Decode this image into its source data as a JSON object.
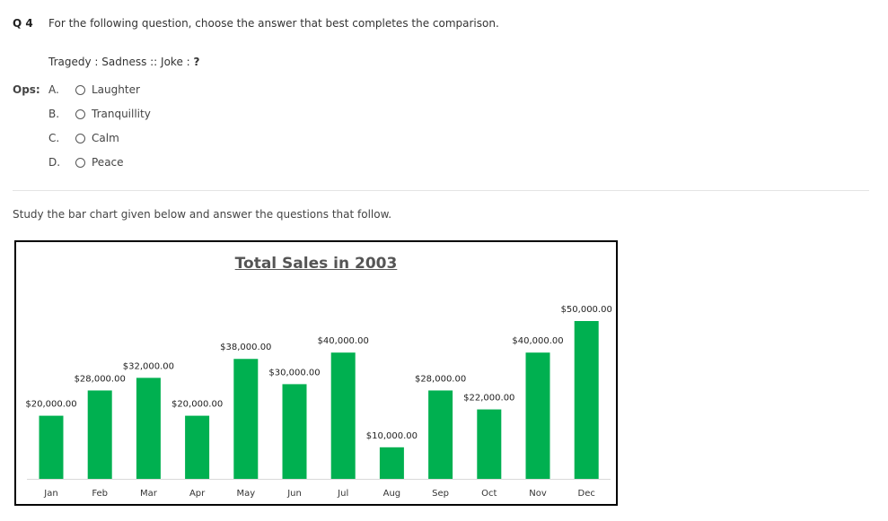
{
  "question": {
    "number": "Q 4",
    "text": "For the following question, choose the answer that best completes the comparison.",
    "analogy_prefix": "Tragedy : Sadness :: Joke : ",
    "analogy_blank": "?",
    "options_label": "Ops:",
    "options": [
      {
        "letter": "A.",
        "text": "Laughter"
      },
      {
        "letter": "B.",
        "text": "Tranquillity"
      },
      {
        "letter": "C.",
        "text": "Calm"
      },
      {
        "letter": "D.",
        "text": "Peace"
      }
    ]
  },
  "instruction": "Study the bar chart given below and answer the questions that follow.",
  "colors": {
    "bar": "#00b050",
    "frame": "#000000",
    "axis": "#d9d9d9"
  },
  "chart_data": {
    "type": "bar",
    "title": "Total Sales in 2003",
    "xlabel": "",
    "ylabel": "",
    "categories": [
      "Jan",
      "Feb",
      "Mar",
      "Apr",
      "May",
      "Jun",
      "Jul",
      "Aug",
      "Sep",
      "Oct",
      "Nov",
      "Dec"
    ],
    "values": [
      20000,
      28000,
      32000,
      20000,
      38000,
      30000,
      40000,
      10000,
      28000,
      22000,
      40000,
      50000
    ],
    "data_labels": [
      "$20,000.00",
      "$28,000.00",
      "$32,000.00",
      "$20,000.00",
      "$38,000.00",
      "$30,000.00",
      "$40,000.00",
      "$10,000.00",
      "$28,000.00",
      "$22,000.00",
      "$40,000.00",
      "$50,000.00"
    ],
    "ylim": [
      0,
      50000
    ],
    "grid": false,
    "legend": "none"
  }
}
